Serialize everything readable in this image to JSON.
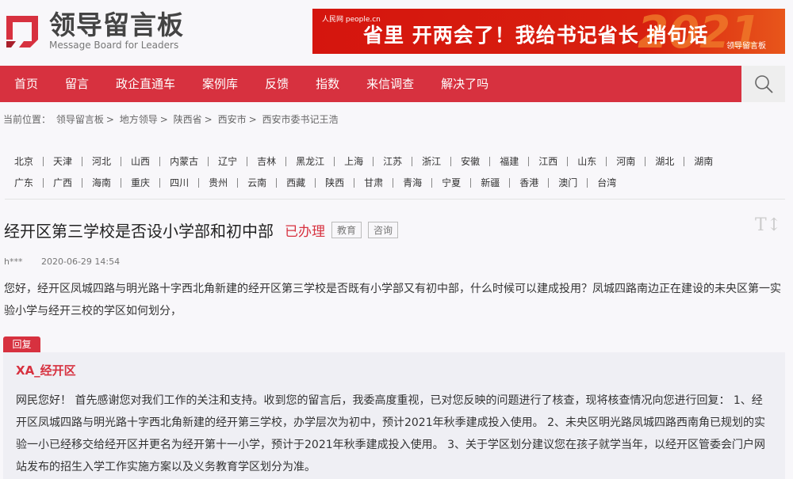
{
  "logo": {
    "cn": "领导留言板",
    "en": "Message Board for Leaders"
  },
  "banner": {
    "source": "人民网 people.cn",
    "text": "省里 开两会了！我给书记省长 捎句话",
    "year": "2021",
    "logo": "领导留言板"
  },
  "nav": {
    "items": [
      "首页",
      "留言",
      "政企直通车",
      "案例库",
      "反馈",
      "指数",
      "来信调查",
      "解决了吗"
    ]
  },
  "breadcrumb": {
    "label": "当前位置：",
    "items": [
      "领导留言板",
      "地方领导",
      "陕西省",
      "西安市",
      "西安市委书记王浩"
    ],
    "sep": ">"
  },
  "provinces": {
    "row1": [
      "北京",
      "天津",
      "河北",
      "山西",
      "内蒙古",
      "辽宁",
      "吉林",
      "黑龙江",
      "上海",
      "江苏",
      "浙江",
      "安徽",
      "福建",
      "江西",
      "山东",
      "河南",
      "湖北",
      "湖南"
    ],
    "row2": [
      "广东",
      "广西",
      "海南",
      "重庆",
      "四川",
      "贵州",
      "云南",
      "西藏",
      "陕西",
      "甘肃",
      "青海",
      "宁夏",
      "新疆",
      "香港",
      "澳门",
      "台湾"
    ]
  },
  "message": {
    "title": "经开区第三学校是否设小学部和初中部",
    "status": "已办理",
    "tags": [
      "教育",
      "咨询"
    ],
    "font_toggle": "T",
    "user": "h***",
    "time": "2020-06-29 14:54",
    "body": "您好，经开区凤城四路与明光路十字西北角新建的经开区第三学校是否既有小学部又有初中部，什么时候可以建成投用？凤城四路南边正在建设的未央区第一实验小学与经开三校的学区如何划分，"
  },
  "reply": {
    "tab": "回复",
    "replier": "XA_经开区",
    "body": "网民您好！ 首先感谢您对我们工作的关注和支持。收到您的留言后，我委高度重视，已对您反映的问题进行了核查，现将核查情况向您进行回复： 1、经开区凤城四路与明光路十字西北角新建的经开第三学校，办学层次为初中，预计2021年秋季建成投入使用。 2、未央区明光路凤城四路西南角已规划的实验一小已经移交给经开区并更名为经开第十一小学，预计于2021年秋季建成投入使用。 3、关于学区划分建议您在孩子就学当年，以经开区管委会门户网站发布的招生入学工作实施方案以及义务教育学区划分为准。"
  }
}
